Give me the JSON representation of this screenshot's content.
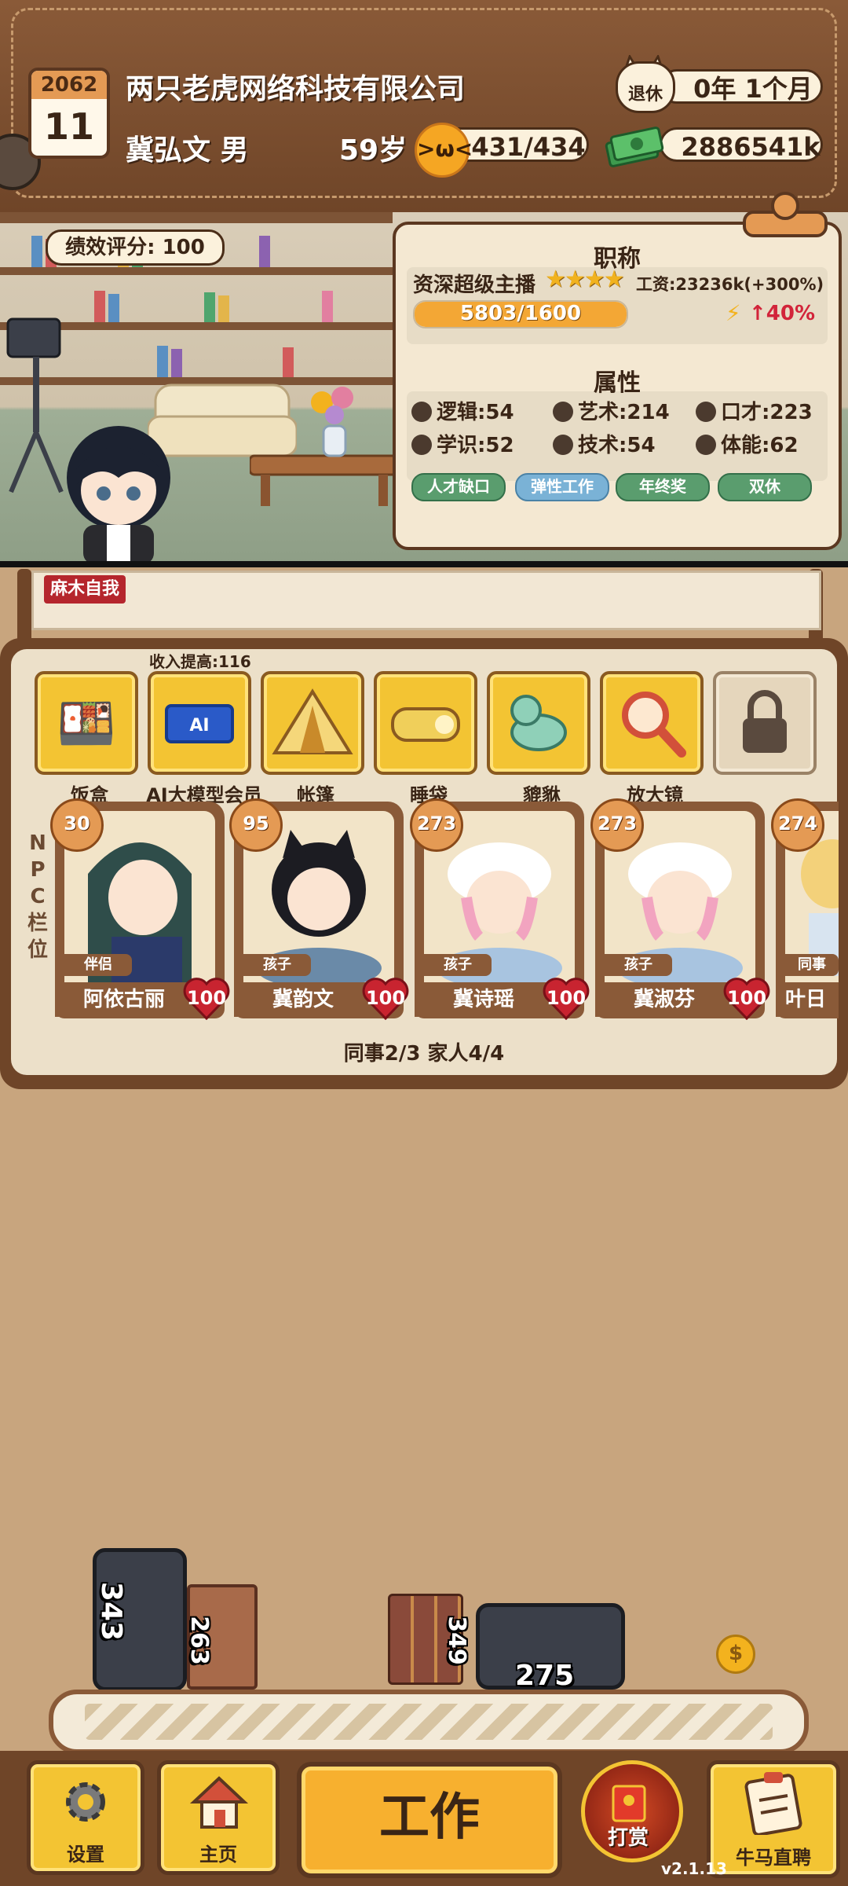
{
  "header": {
    "calendar_year": "2062",
    "calendar_day": "11",
    "company_name": "两只老虎网络科技有限公司",
    "player_name_gender": "冀弘文 男",
    "age": "59岁",
    "retire_label": "退休",
    "retire_time": "0年  1个月",
    "mood": "431/434",
    "money": "2886541k"
  },
  "scene": {
    "performance_label": "绩效评分:",
    "performance_value": "100"
  },
  "card": {
    "title_label": "职称",
    "job_title": "资深超级主播",
    "stars": "★★★★",
    "salary": "工资:23236k(+300%)",
    "xp_text": "5803/1600",
    "xp_fill_percent": 100,
    "boost": "↑40%",
    "attributes_label": "属性",
    "attributes": [
      {
        "name": "逻辑:54",
        "icon": "brain-icon"
      },
      {
        "name": "艺术:214",
        "icon": "music-note-icon"
      },
      {
        "name": "口才:223",
        "icon": "lips-icon"
      },
      {
        "name": "学识:52",
        "icon": "book-icon"
      },
      {
        "name": "技术:54",
        "icon": "monitor-icon"
      },
      {
        "name": "体能:62",
        "icon": "shield-icon"
      }
    ],
    "tags": [
      "人才缺口",
      "弹性工作",
      "年终奖",
      "双休"
    ]
  },
  "event": {
    "tag": "麻木自我"
  },
  "items": {
    "income_boost": "收入提高:116",
    "list": [
      {
        "label": "饭盒",
        "icon": "lunchbox-icon"
      },
      {
        "label": "AI大模型会员",
        "icon": "ai-card-icon"
      },
      {
        "label": "帐篷",
        "icon": "tent-icon"
      },
      {
        "label": "睡袋",
        "icon": "sleeping-bag-icon"
      },
      {
        "label": "貔貅",
        "icon": "pixiu-icon"
      },
      {
        "label": "放大镜",
        "icon": "magnifier-icon"
      },
      {
        "label": "",
        "icon": "lock-icon"
      }
    ]
  },
  "npc": {
    "side_label": [
      "N",
      "P",
      "C",
      "栏",
      "位"
    ],
    "list": [
      {
        "level": "30",
        "role": "伴侣",
        "name": "阿依古丽",
        "affection": "100"
      },
      {
        "level": "95",
        "role": "孩子",
        "name": "冀韵文",
        "affection": "100"
      },
      {
        "level": "273",
        "role": "孩子",
        "name": "冀诗瑶",
        "affection": "100"
      },
      {
        "level": "273",
        "role": "孩子",
        "name": "冀淑芬",
        "affection": "100"
      },
      {
        "level": "274",
        "role": "同事",
        "name": "叶日",
        "affection": ""
      }
    ],
    "team_count": "同事2/3 家人4/4"
  },
  "conveyor": {
    "values": [
      "343",
      "263",
      "349",
      "275"
    ]
  },
  "bottom": {
    "settings_label": "设置",
    "home_label": "主页",
    "work_label": "工作",
    "reward_label": "打赏",
    "live_label": "牛马直聘",
    "version": "v2.1.13"
  },
  "colors": {
    "leather": "#6f4528",
    "gold": "#f3c433",
    "cream": "#f4e8d2",
    "heart_red": "#c82430"
  }
}
